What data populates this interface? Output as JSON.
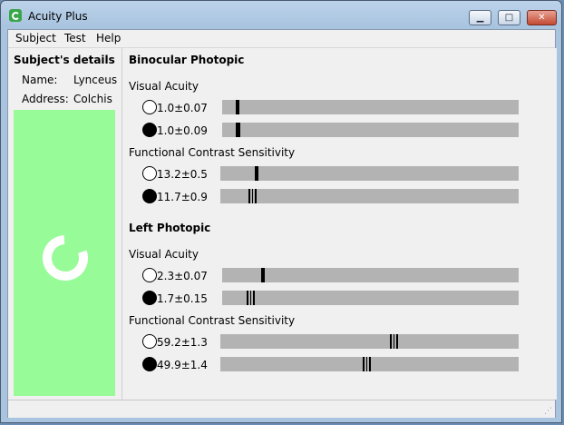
{
  "window": {
    "title": "Acuity Plus"
  },
  "menu": [
    {
      "label": "Subject"
    },
    {
      "label": "Test"
    },
    {
      "label": "Help"
    }
  ],
  "subject": {
    "heading": "Subject's details",
    "name_label": "Name:",
    "name_value": "Lynceus",
    "address_label": "Address:",
    "address_value": "Colchis"
  },
  "sections": [
    {
      "title": "Binocular Photopic",
      "tests": [
        {
          "label": "Visual Acuity",
          "rows": [
            {
              "eye": "open",
              "value": "1.0±0.07"
            },
            {
              "eye": "filled",
              "value": "1.0±0.09"
            }
          ]
        },
        {
          "label": "Functional Contrast Sensitivity",
          "rows": [
            {
              "eye": "open",
              "value": "13.2±0.5"
            },
            {
              "eye": "filled",
              "value": "11.7±0.9"
            }
          ]
        }
      ]
    },
    {
      "title": "Left Photopic",
      "tests": [
        {
          "label": "Visual Acuity",
          "rows": [
            {
              "eye": "open",
              "value": "2.3±0.07"
            },
            {
              "eye": "filled",
              "value": "1.7±0.15"
            }
          ]
        },
        {
          "label": "Functional Contrast Sensitivity",
          "rows": [
            {
              "eye": "open",
              "value": "59.2±1.3"
            },
            {
              "eye": "filled",
              "value": "49.9±1.4"
            }
          ]
        }
      ]
    }
  ],
  "colors": {
    "accent_green": "#97fb97",
    "bar_gray": "#b3b3b3"
  }
}
